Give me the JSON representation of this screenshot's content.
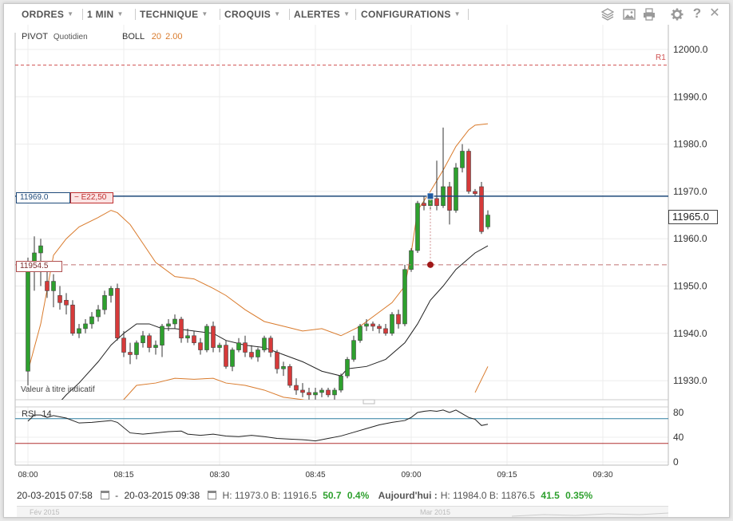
{
  "toolbar": {
    "menus": [
      "ORDRES",
      "1 MIN",
      "TECHNIQUE",
      "CROQUIS",
      "ALERTES",
      "CONFIGURATIONS"
    ]
  },
  "indicators": {
    "pivot_label": "PIVOT",
    "pivot_period": "Quotidien",
    "boll_label": "BOLL",
    "boll_p1": "20",
    "boll_p2": "2.00",
    "rsi_label": "RSI",
    "rsi_period": "14",
    "r1_label": "R1",
    "note": "Valeur à titre indicatif"
  },
  "labels": {
    "order_price": "11969.0",
    "order_pl": "− E22,50",
    "stop_price": "11954.5",
    "current_price": "11965.0"
  },
  "status": {
    "date_from": "20-03-2015 07:58",
    "dash": "-",
    "date_to": "20-03-2015 09:38",
    "range": "H: 11973.0  B: 11916.5",
    "range_change": "50.7",
    "range_pct": "0.4%",
    "today_label": "Aujourd'hui :",
    "today_range": "H: 11984.0  B: 11876.5",
    "today_change": "41.5",
    "today_pct": "0.35%"
  },
  "navigator": {
    "left_label": "Fév 2015",
    "mid_label": "Mar 2015"
  },
  "colors": {
    "bull": "#2ea02e",
    "bear": "#d63a3a",
    "boll": "#d97a2b",
    "sma": "#222222",
    "order_line": "#1f4a7a",
    "stop_line": "#c07070",
    "r1": "#d05050",
    "rsi": "#222222",
    "rsi_upper": "#2f7fa0",
    "rsi_lower": "#b03030",
    "positive": "#2ea02e"
  },
  "chart_data": {
    "type": "candlestick",
    "price_axis": {
      "ticks": [
        12000.0,
        11990.0,
        11980.0,
        11970.0,
        11960.0,
        11950.0,
        11940.0,
        11930.0
      ],
      "range": [
        11928,
        12003
      ]
    },
    "time_axis": {
      "ticks": [
        "08:00",
        "08:15",
        "08:30",
        "08:45",
        "09:00",
        "09:15",
        "09:30"
      ]
    },
    "rsi_axis": {
      "ticks": [
        80,
        40,
        0
      ],
      "upper": 70,
      "lower": 30
    },
    "r1": 11996.7,
    "order_level": 11969.0,
    "stop_level": 11954.5,
    "order_marker": {
      "t": "09:03",
      "price": 11969.0
    },
    "stop_marker": {
      "t": "09:03",
      "price": 11954.5
    },
    "candles": [
      [
        "08:00",
        11932.0,
        11956.0,
        11929.0,
        11955.0
      ],
      [
        "08:01",
        11955.0,
        11960.5,
        11949.0,
        11957.0
      ],
      [
        "08:02",
        11957.0,
        11960.0,
        11950.0,
        11958.5
      ],
      [
        "08:03",
        11951.0,
        11953.0,
        11947.5,
        11949.0
      ],
      [
        "08:04",
        11949.0,
        11952.5,
        11945.5,
        11951.0
      ],
      [
        "08:05",
        11948.0,
        11950.0,
        11945.0,
        11946.5
      ],
      [
        "08:06",
        11947.0,
        11948.5,
        11944.0,
        11946.0
      ],
      [
        "08:07",
        11946.0,
        11947.0,
        11939.5,
        11940.0
      ],
      [
        "08:08",
        11940.0,
        11942.0,
        11939.0,
        11941.0
      ],
      [
        "08:09",
        11941.0,
        11943.0,
        11940.0,
        11942.0
      ],
      [
        "08:10",
        11942.0,
        11944.5,
        11941.0,
        11943.5
      ],
      [
        "08:11",
        11943.5,
        11946.0,
        11942.5,
        11945.0
      ],
      [
        "08:12",
        11945.0,
        11949.0,
        11944.0,
        11948.0
      ],
      [
        "08:13",
        11948.0,
        11950.0,
        11946.5,
        11949.5
      ],
      [
        "08:14",
        11949.5,
        11950.5,
        11938.5,
        11939.0
      ],
      [
        "08:15",
        11939.0,
        11940.5,
        11935.0,
        11936.0
      ],
      [
        "08:16",
        11936.0,
        11938.0,
        11933.5,
        11935.5
      ],
      [
        "08:17",
        11935.5,
        11938.5,
        11934.5,
        11938.0
      ],
      [
        "08:18",
        11938.0,
        11940.5,
        11937.0,
        11939.5
      ],
      [
        "08:19",
        11939.5,
        11940.0,
        11936.0,
        11937.0
      ],
      [
        "08:20",
        11937.0,
        11938.5,
        11935.5,
        11937.5
      ],
      [
        "08:21",
        11937.5,
        11942.0,
        11935.0,
        11941.5
      ],
      [
        "08:22",
        11941.5,
        11943.0,
        11940.5,
        11942.0
      ],
      [
        "08:23",
        11942.0,
        11944.0,
        11941.0,
        11943.0
      ],
      [
        "08:24",
        11943.0,
        11943.5,
        11938.0,
        11939.0
      ],
      [
        "08:25",
        11939.0,
        11941.0,
        11938.0,
        11939.5
      ],
      [
        "08:26",
        11939.5,
        11940.5,
        11937.5,
        11938.0
      ],
      [
        "08:27",
        11938.0,
        11939.0,
        11935.5,
        11936.5
      ],
      [
        "08:28",
        11936.5,
        11942.0,
        11936.0,
        11941.5
      ],
      [
        "08:29",
        11941.5,
        11942.5,
        11936.0,
        11937.0
      ],
      [
        "08:30",
        11937.0,
        11938.0,
        11936.0,
        11937.5
      ],
      [
        "08:31",
        11937.5,
        11938.5,
        11932.5,
        11933.0
      ],
      [
        "08:32",
        11933.0,
        11937.0,
        11932.0,
        11936.5
      ],
      [
        "08:33",
        11936.5,
        11939.0,
        11936.0,
        11938.0
      ],
      [
        "08:34",
        11938.0,
        11939.5,
        11935.0,
        11936.0
      ],
      [
        "08:35",
        11936.0,
        11937.5,
        11934.5,
        11935.0
      ],
      [
        "08:36",
        11935.0,
        11937.0,
        11934.0,
        11936.5
      ],
      [
        "08:37",
        11936.5,
        11939.5,
        11936.0,
        11939.0
      ],
      [
        "08:38",
        11939.0,
        11939.5,
        11935.0,
        11936.0
      ],
      [
        "08:39",
        11936.0,
        11936.5,
        11931.5,
        11932.5
      ],
      [
        "08:40",
        11932.5,
        11934.0,
        11931.0,
        11933.0
      ],
      [
        "08:41",
        11933.0,
        11933.5,
        11928.5,
        11929.0
      ],
      [
        "08:42",
        11929.0,
        11930.5,
        11927.0,
        11928.0
      ],
      [
        "08:43",
        11928.0,
        11929.5,
        11926.5,
        11927.5
      ],
      [
        "08:44",
        11927.5,
        11928.5,
        11926.0,
        11927.0
      ],
      [
        "08:45",
        11927.0,
        11928.5,
        11926.0,
        11927.5
      ],
      [
        "08:46",
        11927.5,
        11928.5,
        11926.5,
        11928.0
      ],
      [
        "08:47",
        11928.0,
        11928.5,
        11926.5,
        11927.0
      ],
      [
        "08:48",
        11927.0,
        11928.5,
        11926.0,
        11928.0
      ],
      [
        "08:49",
        11928.0,
        11931.5,
        11927.5,
        11931.0
      ],
      [
        "08:50",
        11931.0,
        11935.0,
        11930.5,
        11934.5
      ],
      [
        "08:51",
        11934.5,
        11939.5,
        11934.0,
        11938.5
      ],
      [
        "08:52",
        11938.5,
        11942.0,
        11938.0,
        11941.5
      ],
      [
        "08:53",
        11941.5,
        11943.0,
        11940.5,
        11942.0
      ],
      [
        "08:54",
        11942.0,
        11942.5,
        11940.5,
        11941.5
      ],
      [
        "08:55",
        11941.5,
        11942.0,
        11940.0,
        11941.0
      ],
      [
        "08:56",
        11941.0,
        11942.0,
        11939.5,
        11940.0
      ],
      [
        "08:57",
        11940.0,
        11944.5,
        11939.5,
        11944.0
      ],
      [
        "08:58",
        11944.0,
        11945.0,
        11941.0,
        11942.0
      ],
      [
        "08:59",
        11942.0,
        11954.5,
        11941.5,
        11953.5
      ],
      [
        "09:00",
        11953.5,
        11958.0,
        11953.0,
        11957.5
      ],
      [
        "09:01",
        11957.5,
        11968.0,
        11957.0,
        11967.5
      ],
      [
        "09:02",
        11967.5,
        11969.0,
        11966.0,
        11967.0
      ],
      [
        "09:03",
        11967.0,
        11969.0,
        11966.0,
        11968.5
      ],
      [
        "09:04",
        11968.5,
        11976.5,
        11966.0,
        11967.0
      ],
      [
        "09:05",
        11967.0,
        11983.5,
        11966.5,
        11971.0
      ],
      [
        "09:06",
        11971.0,
        11972.0,
        11963.0,
        11966.0
      ],
      [
        "09:07",
        11966.0,
        11976.0,
        11965.5,
        11975.0
      ],
      [
        "09:08",
        11975.0,
        11980.0,
        11974.0,
        11978.5
      ],
      [
        "09:09",
        11978.5,
        11979.0,
        11969.5,
        11970.0
      ],
      [
        "09:10",
        11970.0,
        11970.5,
        11969.0,
        11969.5
      ],
      [
        "09:11",
        11971.0,
        11972.0,
        11961.0,
        11961.5
      ],
      [
        "09:12",
        11962.5,
        11966.0,
        11962.0,
        11965.0
      ]
    ],
    "boll_upper": [
      [
        "08:00",
        11932.0
      ],
      [
        "08:02",
        11942.0
      ],
      [
        "08:04",
        11956.5
      ],
      [
        "08:06",
        11960.0
      ],
      [
        "08:08",
        11962.5
      ],
      [
        "08:11",
        11964.5
      ],
      [
        "08:13",
        11966.0
      ],
      [
        "08:14",
        11965.5
      ],
      [
        "08:16",
        11963.0
      ],
      [
        "08:18",
        11959.0
      ],
      [
        "08:20",
        11955.0
      ],
      [
        "08:23",
        11952.0
      ],
      [
        "08:26",
        11951.5
      ],
      [
        "08:29",
        11949.5
      ],
      [
        "08:31",
        11948.0
      ],
      [
        "08:34",
        11945.0
      ],
      [
        "08:37",
        11942.5
      ],
      [
        "08:40",
        11941.5
      ],
      [
        "08:43",
        11940.5
      ],
      [
        "08:46",
        11941.0
      ],
      [
        "08:49",
        11939.5
      ],
      [
        "08:52",
        11941.5
      ],
      [
        "08:55",
        11944.5
      ],
      [
        "08:57",
        11946.5
      ],
      [
        "08:59",
        11950.0
      ],
      [
        "09:00",
        11957.0
      ],
      [
        "09:01",
        11966.0
      ],
      [
        "09:03",
        11970.0
      ],
      [
        "09:05",
        11974.5
      ],
      [
        "09:07",
        11979.5
      ],
      [
        "09:09",
        11983.0
      ],
      [
        "09:10",
        11984.0
      ],
      [
        "09:12",
        11984.3
      ]
    ],
    "boll_lower": [
      [
        "08:13",
        11920.0
      ],
      [
        "08:15",
        11926.0
      ],
      [
        "08:17",
        11929.0
      ],
      [
        "08:20",
        11929.5
      ],
      [
        "08:23",
        11930.5
      ],
      [
        "08:26",
        11930.3
      ],
      [
        "08:29",
        11930.5
      ],
      [
        "08:31",
        11929.5
      ],
      [
        "08:34",
        11929.0
      ],
      [
        "08:37",
        11928.0
      ],
      [
        "08:40",
        11926.5
      ],
      [
        "08:43",
        11926.0
      ],
      [
        "08:46",
        11925.0
      ],
      [
        "09:10",
        11927.5
      ],
      [
        "09:12",
        11933.0
      ]
    ],
    "sma": [
      [
        "08:04",
        11924.0
      ],
      [
        "08:06",
        11927.0
      ],
      [
        "08:08",
        11929.5
      ],
      [
        "08:11",
        11934.0
      ],
      [
        "08:13",
        11937.5
      ],
      [
        "08:15",
        11940.0
      ],
      [
        "08:17",
        11942.0
      ],
      [
        "08:19",
        11942.0
      ],
      [
        "08:21",
        11941.0
      ],
      [
        "08:23",
        11941.0
      ],
      [
        "08:26",
        11940.5
      ],
      [
        "08:29",
        11940.0
      ],
      [
        "08:31",
        11938.5
      ],
      [
        "08:34",
        11937.5
      ],
      [
        "08:37",
        11937.0
      ],
      [
        "08:40",
        11935.5
      ],
      [
        "08:43",
        11934.0
      ],
      [
        "08:46",
        11932.0
      ],
      [
        "08:49",
        11931.0
      ],
      [
        "08:50",
        11932.5
      ],
      [
        "08:53",
        11933.0
      ],
      [
        "08:56",
        11934.5
      ],
      [
        "08:59",
        11938.0
      ],
      [
        "09:01",
        11942.0
      ],
      [
        "09:03",
        11947.0
      ],
      [
        "09:05",
        11950.0
      ],
      [
        "09:07",
        11953.5
      ],
      [
        "09:10",
        11957.0
      ],
      [
        "09:12",
        11958.5
      ]
    ],
    "rsi": [
      [
        "08:00",
        66
      ],
      [
        "08:01",
        76
      ],
      [
        "08:02",
        76
      ],
      [
        "08:03",
        72
      ],
      [
        "08:04",
        75
      ],
      [
        "08:06",
        71
      ],
      [
        "08:08",
        63
      ],
      [
        "08:10",
        64
      ],
      [
        "08:11",
        65
      ],
      [
        "08:13",
        67
      ],
      [
        "08:14",
        64
      ],
      [
        "08:16",
        47
      ],
      [
        "08:18",
        45
      ],
      [
        "08:20",
        47
      ],
      [
        "08:22",
        49
      ],
      [
        "08:24",
        50
      ],
      [
        "08:25",
        45
      ],
      [
        "08:27",
        43
      ],
      [
        "08:29",
        45
      ],
      [
        "08:31",
        42
      ],
      [
        "08:33",
        41
      ],
      [
        "08:35",
        43
      ],
      [
        "08:37",
        41
      ],
      [
        "08:39",
        38
      ],
      [
        "08:41",
        37
      ],
      [
        "08:43",
        36
      ],
      [
        "08:45",
        34
      ],
      [
        "08:47",
        38
      ],
      [
        "08:49",
        42
      ],
      [
        "08:51",
        48
      ],
      [
        "08:53",
        54
      ],
      [
        "08:55",
        60
      ],
      [
        "08:57",
        64
      ],
      [
        "08:59",
        67
      ],
      [
        "09:00",
        72
      ],
      [
        "09:01",
        80
      ],
      [
        "09:02",
        82
      ],
      [
        "09:03",
        83
      ],
      [
        "09:04",
        82
      ],
      [
        "09:05",
        84
      ],
      [
        "09:06",
        80
      ],
      [
        "09:07",
        84
      ],
      [
        "09:08",
        78
      ],
      [
        "09:09",
        72
      ],
      [
        "09:10",
        69
      ],
      [
        "09:11",
        59
      ],
      [
        "09:12",
        61
      ]
    ]
  }
}
